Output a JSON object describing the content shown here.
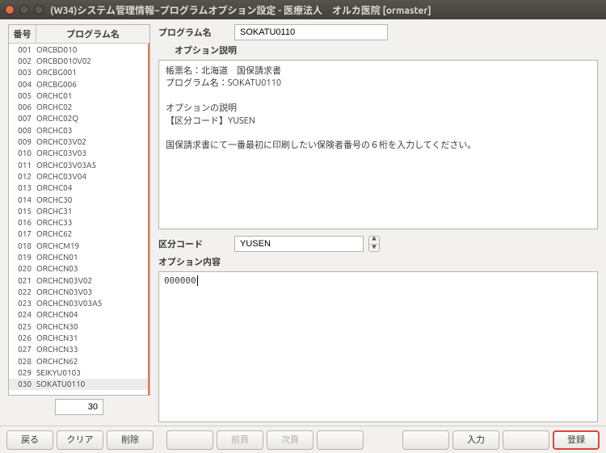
{
  "window": {
    "title": "(W34)システム管理情報−プログラムオプション設定 - 医療法人　オルカ医院 [ormaster]"
  },
  "table": {
    "headers": {
      "no": "番号",
      "name": "プログラム名"
    },
    "rows": [
      {
        "no": "001",
        "name": "ORCBD010"
      },
      {
        "no": "002",
        "name": "ORCBD010V02"
      },
      {
        "no": "003",
        "name": "ORCBG001"
      },
      {
        "no": "004",
        "name": "ORCBG006"
      },
      {
        "no": "005",
        "name": "ORCHC01"
      },
      {
        "no": "006",
        "name": "ORCHC02"
      },
      {
        "no": "007",
        "name": "ORCHC02Q"
      },
      {
        "no": "008",
        "name": "ORCHC03"
      },
      {
        "no": "009",
        "name": "ORCHC03V02"
      },
      {
        "no": "010",
        "name": "ORCHC03V03"
      },
      {
        "no": "011",
        "name": "ORCHC03V03A5"
      },
      {
        "no": "012",
        "name": "ORCHC03V04"
      },
      {
        "no": "013",
        "name": "ORCHC04"
      },
      {
        "no": "014",
        "name": "ORCHC30"
      },
      {
        "no": "015",
        "name": "ORCHC31"
      },
      {
        "no": "016",
        "name": "ORCHC33"
      },
      {
        "no": "017",
        "name": "ORCHC62"
      },
      {
        "no": "018",
        "name": "ORCHCM19"
      },
      {
        "no": "019",
        "name": "ORCHCN01"
      },
      {
        "no": "020",
        "name": "ORCHCN03"
      },
      {
        "no": "021",
        "name": "ORCHCN03V02"
      },
      {
        "no": "022",
        "name": "ORCHCN03V03"
      },
      {
        "no": "023",
        "name": "ORCHCN03V03A5"
      },
      {
        "no": "024",
        "name": "ORCHCN04"
      },
      {
        "no": "025",
        "name": "ORCHCN30"
      },
      {
        "no": "026",
        "name": "ORCHCN31"
      },
      {
        "no": "027",
        "name": "ORCHCN33"
      },
      {
        "no": "028",
        "name": "ORCHCN62"
      },
      {
        "no": "029",
        "name": "SEIKYU0103"
      },
      {
        "no": "030",
        "name": "SOKATU0110"
      }
    ],
    "selected_index": 29,
    "selected_value": "30"
  },
  "form": {
    "program_label": "プログラム名",
    "program_value": "SOKATU0110",
    "option_desc_label": "オプション説明",
    "option_desc_text": "帳票名：北海道　国保請求書\nプログラム名：SOKATU0110\n\nオプションの説明\n【区分コード】YUSEN\n\n国保請求書にて一番最初に印刷したい保険者番号の６桁を入力してください。",
    "kubun_label": "区分コード",
    "kubun_value": "YUSEN",
    "option_content_label": "オプション内容",
    "option_content_value": "000000"
  },
  "footer": {
    "back": "戻る",
    "clear": "クリア",
    "delete": "削除",
    "prev": "前頁",
    "next": "次頁",
    "input": "入力",
    "register": "登録"
  }
}
